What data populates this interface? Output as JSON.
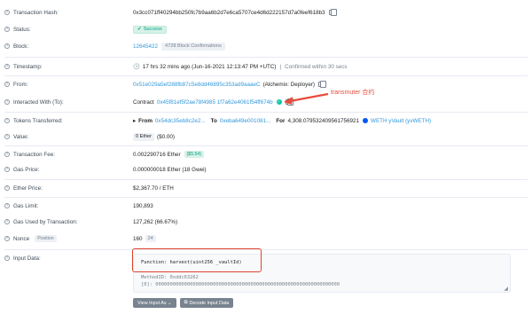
{
  "rows": {
    "tx_hash": {
      "label": "Transaction Hash:",
      "value": "0x3cc071ff40294bb250fc7b9aa6b2d7e6ca5707ce4d6d222157d7a0feef618b3"
    },
    "status": {
      "label": "Status:",
      "value": "Success"
    },
    "block": {
      "label": "Block:",
      "value": "12645422",
      "confirmations": "4728 Block Confirmations"
    },
    "timestamp": {
      "label": "Timestamp:",
      "value": "17 hrs 32 mins ago (Jun-16-2021 12:13:47 PM +UTC)",
      "confirmed": "Confirmed within 30 secs"
    },
    "from": {
      "label": "From:",
      "address": "0x51e029a5ef288fb87c5e8dd46895c353ad9aaaeC",
      "name": "(Alchemix: Deployer)"
    },
    "interacted": {
      "label": "Interacted With (To):",
      "prefix": "Contract",
      "address": "0x45f81ef5f2ae78f4985 1f7a62e4061f54ff674b"
    },
    "tokens": {
      "label": "Tokens Transferred:",
      "from_label": "From",
      "from": "0x54dc35eb8c2e2...",
      "to_label": "To",
      "to": "0xeba649e001081...",
      "for_label": "For",
      "amount": "4,308.079532409561756921",
      "token": "WETH yVault (yvWETH)"
    },
    "value": {
      "label": "Value:",
      "eth": "0 Ether",
      "usd": "($0.00)"
    },
    "fee": {
      "label": "Transaction Fee:",
      "value": "0.002290716 Ether",
      "usd": "($5.54)"
    },
    "gas_price": {
      "label": "Gas Price:",
      "value": "0.000000018 Ether (18 Gwei)"
    },
    "ether_price": {
      "label": "Ether Price:",
      "value": "$2,367.70 / ETH"
    },
    "gas_limit": {
      "label": "Gas Limit:",
      "value": "190,893"
    },
    "gas_used": {
      "label": "Gas Used by Transaction:",
      "value": "127,262 (66.67%)"
    },
    "nonce": {
      "label": "Nonce",
      "position_badge": "Position",
      "value": "160",
      "position": "24"
    },
    "input_data": {
      "label": "Input Data:",
      "function": "Function: harvest(uint256 _vaultId)",
      "method_id": "MethodID: 0xddc63262",
      "arg0": "[0]:  0000000000000000000000000000000000000000000000000000000000000000"
    }
  },
  "annotation": {
    "text": "transmuter 合约"
  },
  "buttons": {
    "view_input": "View Input As ⌄",
    "decode": "Decode Input Data"
  },
  "colors": {
    "link": "#3498db",
    "success": "#00a186",
    "annotation": "#e74c3c"
  }
}
